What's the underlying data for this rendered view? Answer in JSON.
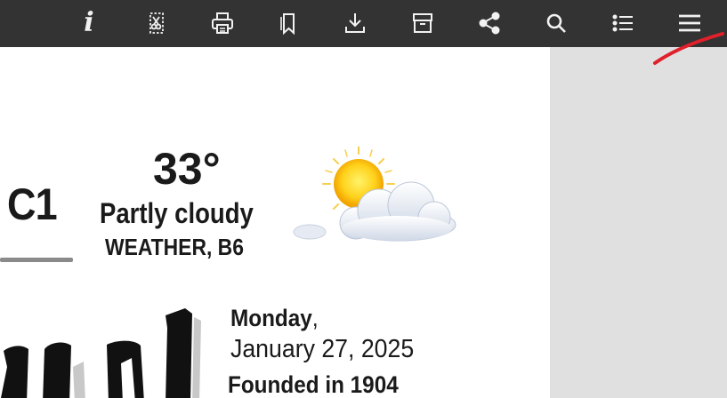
{
  "toolbar": {
    "info_glyph": "i",
    "buttons": [
      "info-icon",
      "clip-icon",
      "print-icon",
      "bookmark-icon",
      "download-icon",
      "archive-icon",
      "share-icon",
      "search-icon",
      "list-icon",
      "menu-icon"
    ]
  },
  "page": {
    "section_label": "C1",
    "weather": {
      "temperature": "33°",
      "condition": "Partly cloudy",
      "reference": "WEATHER, B6",
      "icon": "partly-cloudy-icon"
    },
    "date_block": {
      "day": "Monday",
      "day_suffix": ",",
      "date": "January 27, 2025",
      "founded": "Founded in 1904"
    }
  },
  "colors": {
    "toolbar_bg": "#333333",
    "toolbar_icon": "#f2f2f2",
    "side_panel_bg": "#e0e0e0",
    "ink_mark": "#e0202a"
  }
}
